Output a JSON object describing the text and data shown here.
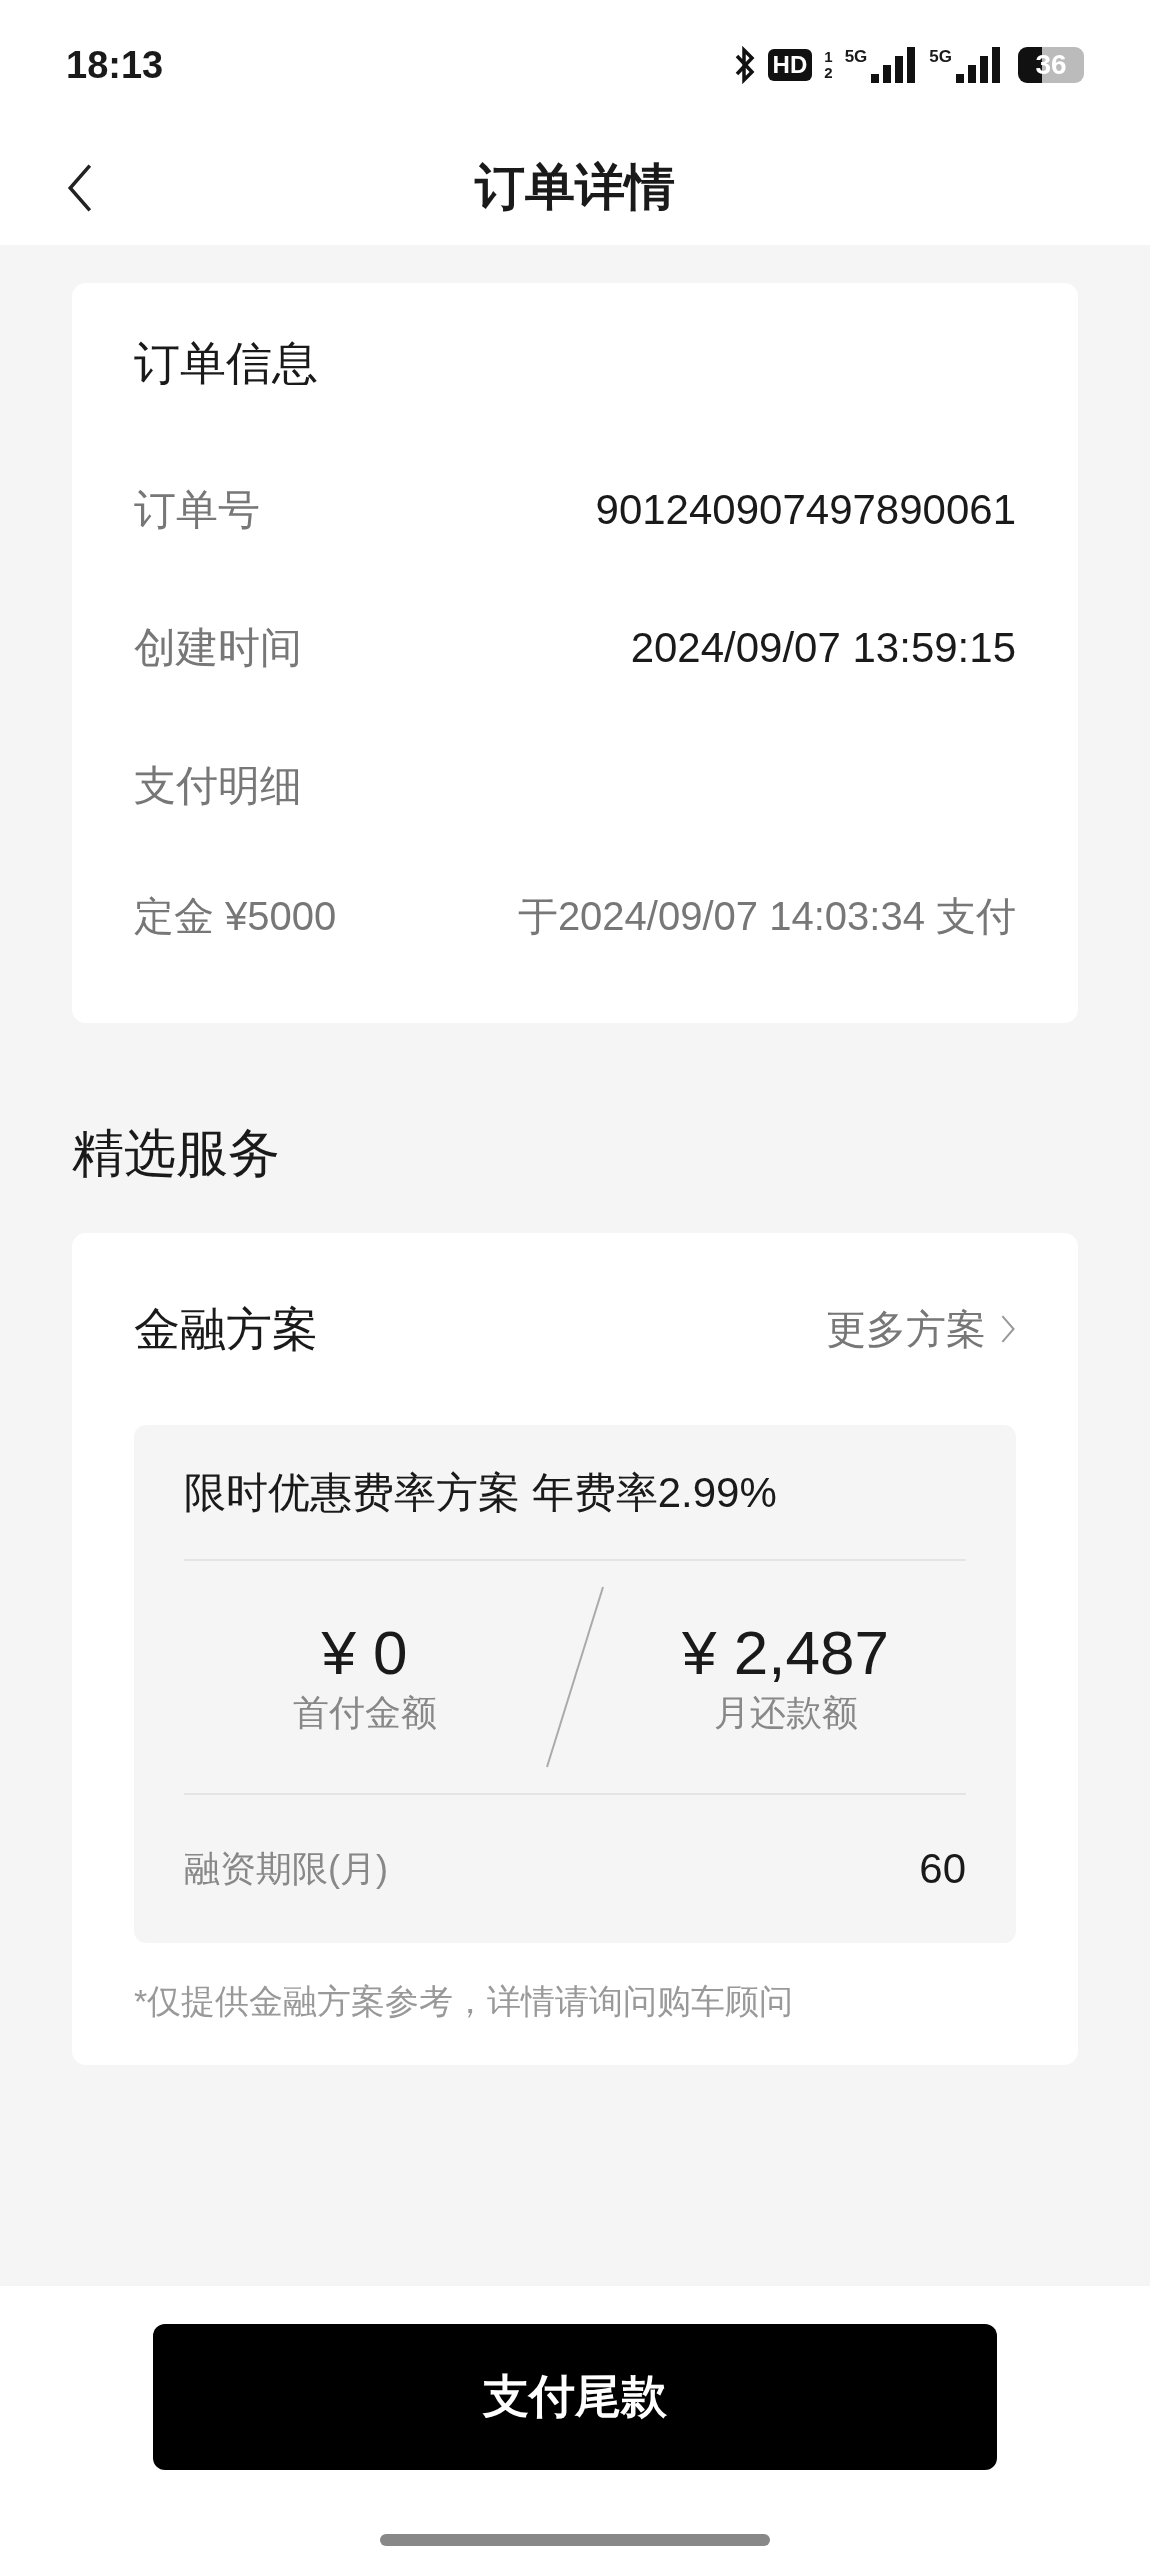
{
  "status_bar": {
    "time": "18:13",
    "hd_badge": "HD",
    "sim_slots": [
      "1",
      "2"
    ],
    "networks": [
      "5G",
      "5G"
    ],
    "battery": "36"
  },
  "nav": {
    "title": "订单详情"
  },
  "order_info": {
    "title": "订单信息",
    "rows": [
      {
        "label": "订单号",
        "value": "901240907497890061"
      },
      {
        "label": "创建时间",
        "value": "2024/09/07 13:59:15"
      }
    ],
    "payment": {
      "title": "支付明细",
      "items": [
        {
          "label": "定金 ¥5000",
          "value": "于2024/09/07 14:03:34 支付"
        }
      ]
    }
  },
  "section_title": "精选服务",
  "finance": {
    "title": "金融方案",
    "more_link": "更多方案",
    "plan": {
      "name": "限时优惠费率方案 年费率2.99%",
      "figures": [
        {
          "amount": "¥ 0",
          "caption": "首付金额"
        },
        {
          "amount": "¥ 2,487",
          "caption": "月还款额"
        }
      ],
      "term_label": "融资期限(月)",
      "term_value": "60"
    },
    "note": "*仅提供金融方案参考，详情请询问购车顾问"
  },
  "pay_button": "支付尾款"
}
